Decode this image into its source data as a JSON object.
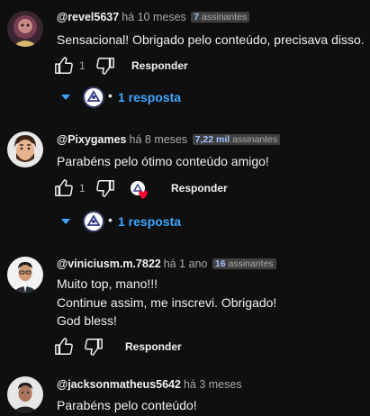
{
  "comments": [
    {
      "handle": "@revel5637",
      "time": "há 10 meses",
      "subs_count": "7",
      "subs_label": "assinantes",
      "lines": [
        "Sensacional! Obrigado pelo conteúdo, precisava disso."
      ],
      "likes": "1",
      "reply_label": "Responder",
      "replies_label": "1 resposta",
      "has_creator_heart": false
    },
    {
      "handle": "@Pixygames",
      "time": "há 8 meses",
      "subs_count": "7,22 mil",
      "subs_label": "assinantes",
      "lines": [
        "Parabéns pelo ótimo conteúdo amigo!"
      ],
      "likes": "1",
      "reply_label": "Responder",
      "replies_label": "1 resposta",
      "has_creator_heart": true
    },
    {
      "handle": "@viniciusm.m.7822",
      "time": "há 1 ano",
      "subs_count": "16",
      "subs_label": "assinantes",
      "lines": [
        "Muito top, mano!!!",
        "Continue assim, me inscrevi. Obrigado!",
        "God bless!"
      ],
      "likes": "",
      "reply_label": "Responder"
    },
    {
      "handle": "@jacksonmatheus5642",
      "time": "há 3 meses",
      "lines": [
        "Parabéns pelo conteúdo!"
      ]
    }
  ],
  "icons": {
    "like": "thumbs-up-icon",
    "dislike": "thumbs-down-icon",
    "expand": "caret-down-icon",
    "heart": "creator-heart-icon"
  },
  "colors": {
    "background": "#0f0f0f",
    "link": "#3ea6ff",
    "muted": "#aaaaaa",
    "heart": "#ff0033"
  }
}
